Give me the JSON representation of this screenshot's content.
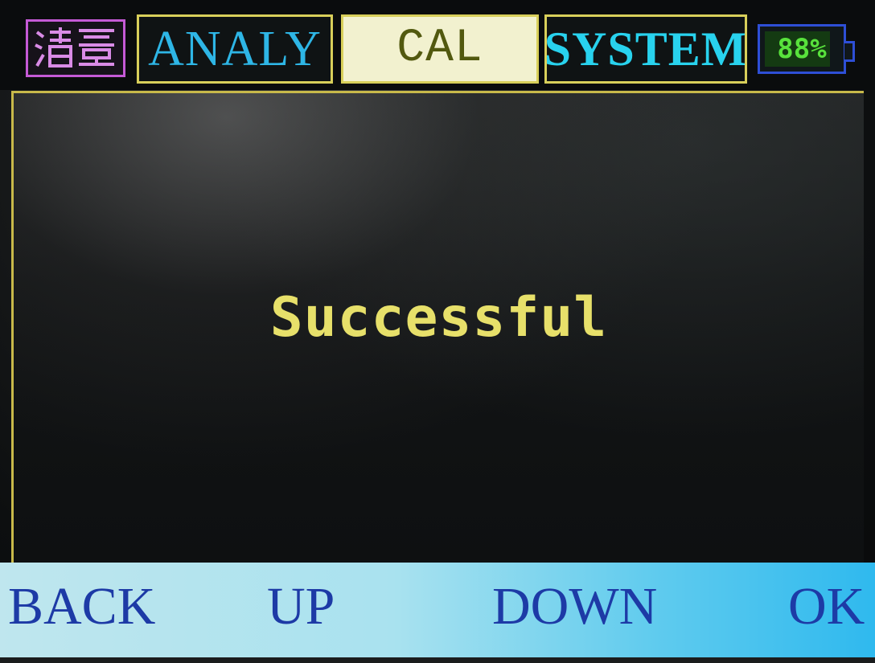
{
  "tabs": {
    "cn_icon": "清零",
    "analy": "ANALY",
    "cal": "CAL",
    "system": "SYSTEM"
  },
  "battery": {
    "text": "88%",
    "level": 0.88,
    "color": "#58e23c"
  },
  "message": {
    "text": "Successful",
    "color": "#e7e06a"
  },
  "softkeys": {
    "back": "BACK",
    "up": "UP",
    "down": "DOWN",
    "ok": "OK"
  },
  "colors": {
    "tab_border": "#d8cf5a",
    "active_tab_bg": "#f2f1cf",
    "softkey_text": "#1d3aa6",
    "cn_tab_border": "#c55ad6"
  },
  "icons": {
    "cn_tab": "zero-clear-icon",
    "battery": "battery-icon"
  }
}
